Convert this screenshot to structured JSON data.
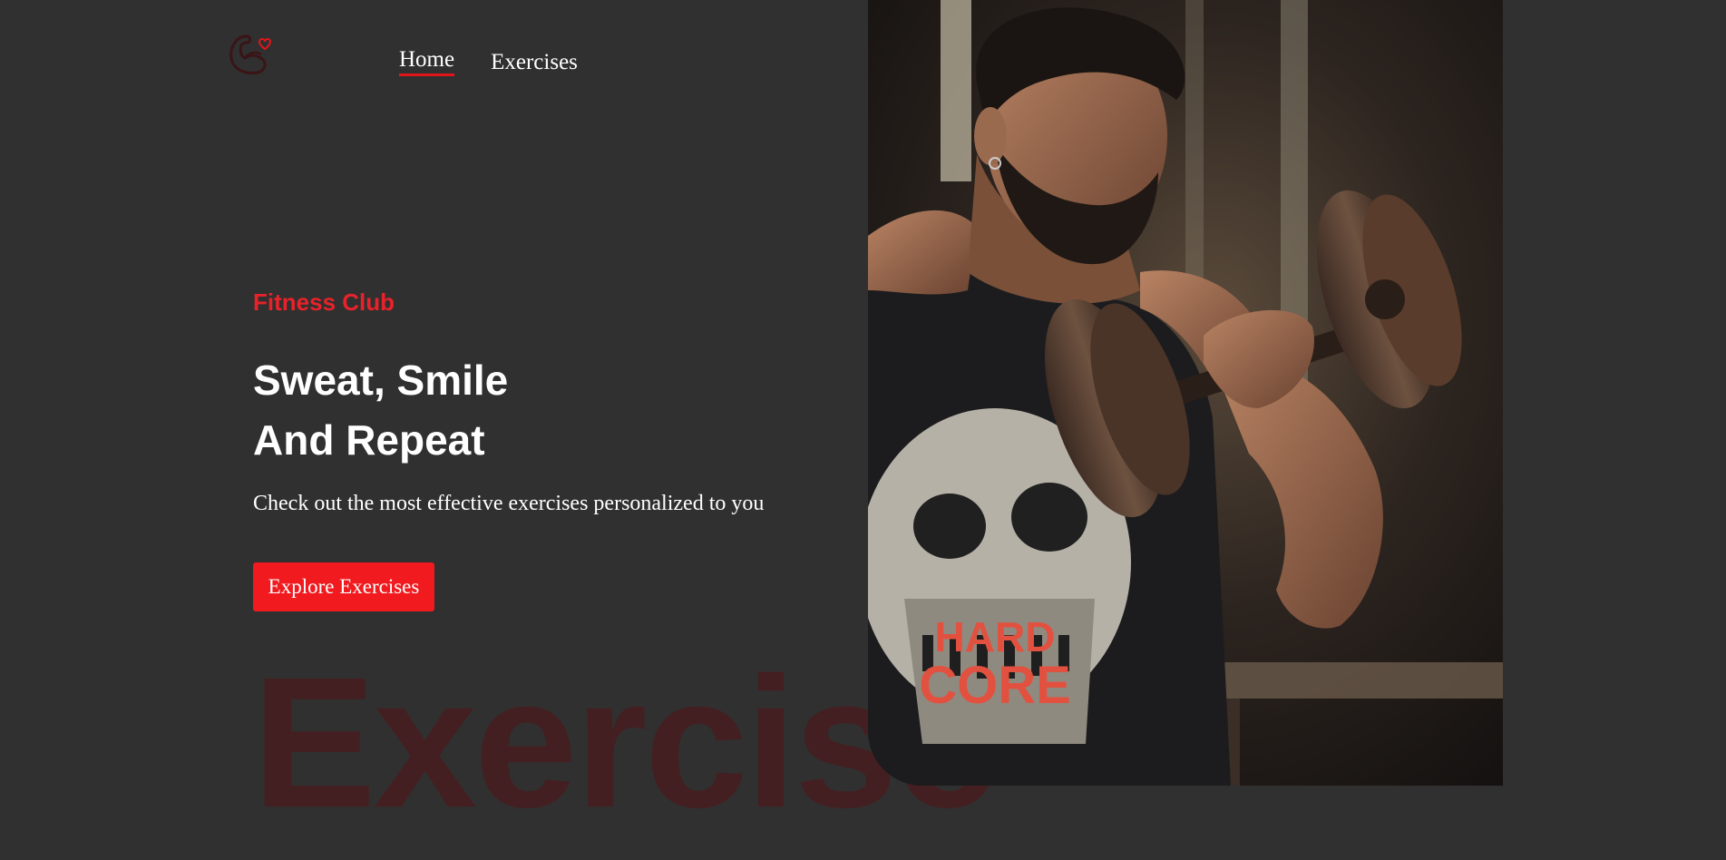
{
  "header": {
    "logo_icon": "flexed-bicep-heart-icon",
    "nav": [
      {
        "label": "Home",
        "active": true
      },
      {
        "label": "Exercises",
        "active": false
      }
    ]
  },
  "hero": {
    "kicker": "Fitness Club",
    "headline_line1": "Sweat, Smile",
    "headline_line2": "And Repeat",
    "subtitle": "Check out the most effective exercises personalized to you",
    "cta_label": "Explore Exercises",
    "watermark": "Exercise",
    "image_description_icon": "athlete-dumbbell-photo",
    "shirt_text_line1": "HARD",
    "shirt_text_line2": "CORE"
  },
  "colors": {
    "background": "#303030",
    "accent": "#f01a1f",
    "watermark": "#441f21",
    "text": "#ffffff"
  }
}
